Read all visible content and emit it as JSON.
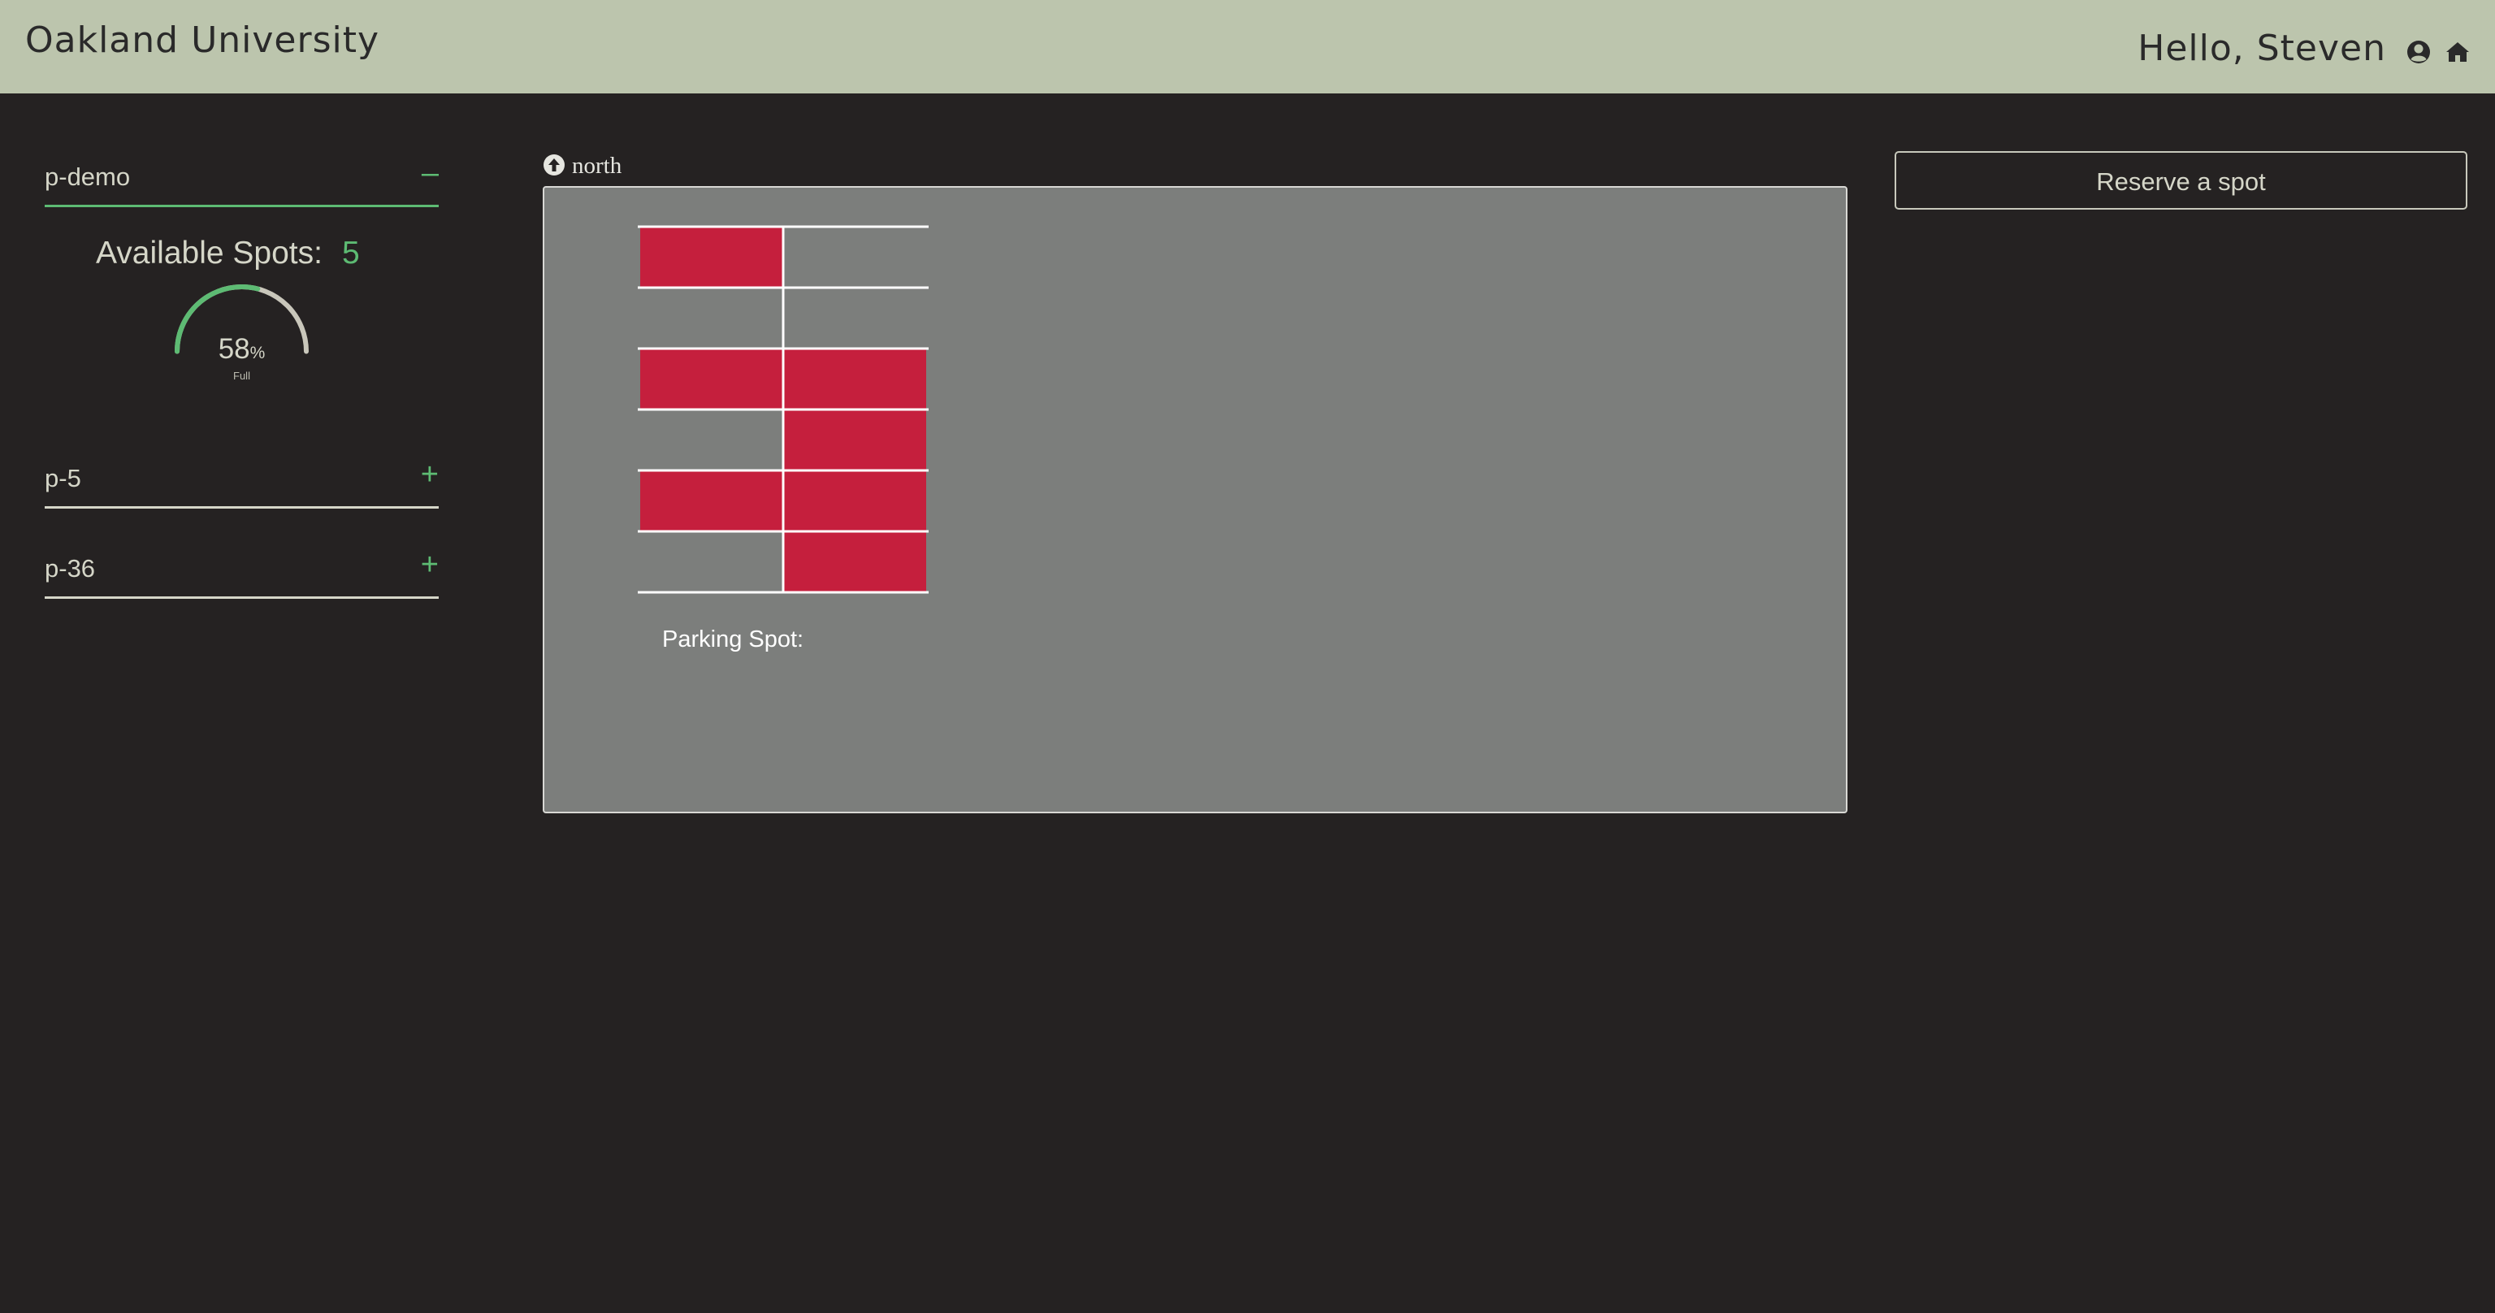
{
  "header": {
    "brand": "Oakland University",
    "greeting": "Hello, Steven",
    "icons": [
      "user-circle-icon",
      "home-icon"
    ],
    "background": "#bcc5ad"
  },
  "sidebar": {
    "lots": [
      {
        "name": "p-demo",
        "toggle": "–",
        "expanded": true
      },
      {
        "name": "p-5",
        "toggle": "+",
        "expanded": false
      },
      {
        "name": "p-36",
        "toggle": "+",
        "expanded": false
      }
    ],
    "available_label": "Available Spots:",
    "available_count": "5",
    "gauge": {
      "value": "58",
      "unit": "%",
      "caption": "Full",
      "fraction": 0.58
    },
    "accent": "#5dbb73"
  },
  "map": {
    "direction_label": "north",
    "spot_label": "Parking Spot:",
    "occupied_color": "#c51f3d",
    "spots": [
      {
        "col": 0,
        "row": 0,
        "occupied": true
      },
      {
        "col": 1,
        "row": 0,
        "occupied": false
      },
      {
        "col": 0,
        "row": 1,
        "occupied": false
      },
      {
        "col": 1,
        "row": 1,
        "occupied": false
      },
      {
        "col": 0,
        "row": 2,
        "occupied": true
      },
      {
        "col": 1,
        "row": 2,
        "occupied": true
      },
      {
        "col": 0,
        "row": 3,
        "occupied": false
      },
      {
        "col": 1,
        "row": 3,
        "occupied": true
      },
      {
        "col": 0,
        "row": 4,
        "occupied": true
      },
      {
        "col": 1,
        "row": 4,
        "occupied": true
      },
      {
        "col": 0,
        "row": 5,
        "occupied": false
      },
      {
        "col": 1,
        "row": 5,
        "occupied": true
      }
    ]
  },
  "actions": {
    "reserve_label": "Reserve a spot"
  }
}
